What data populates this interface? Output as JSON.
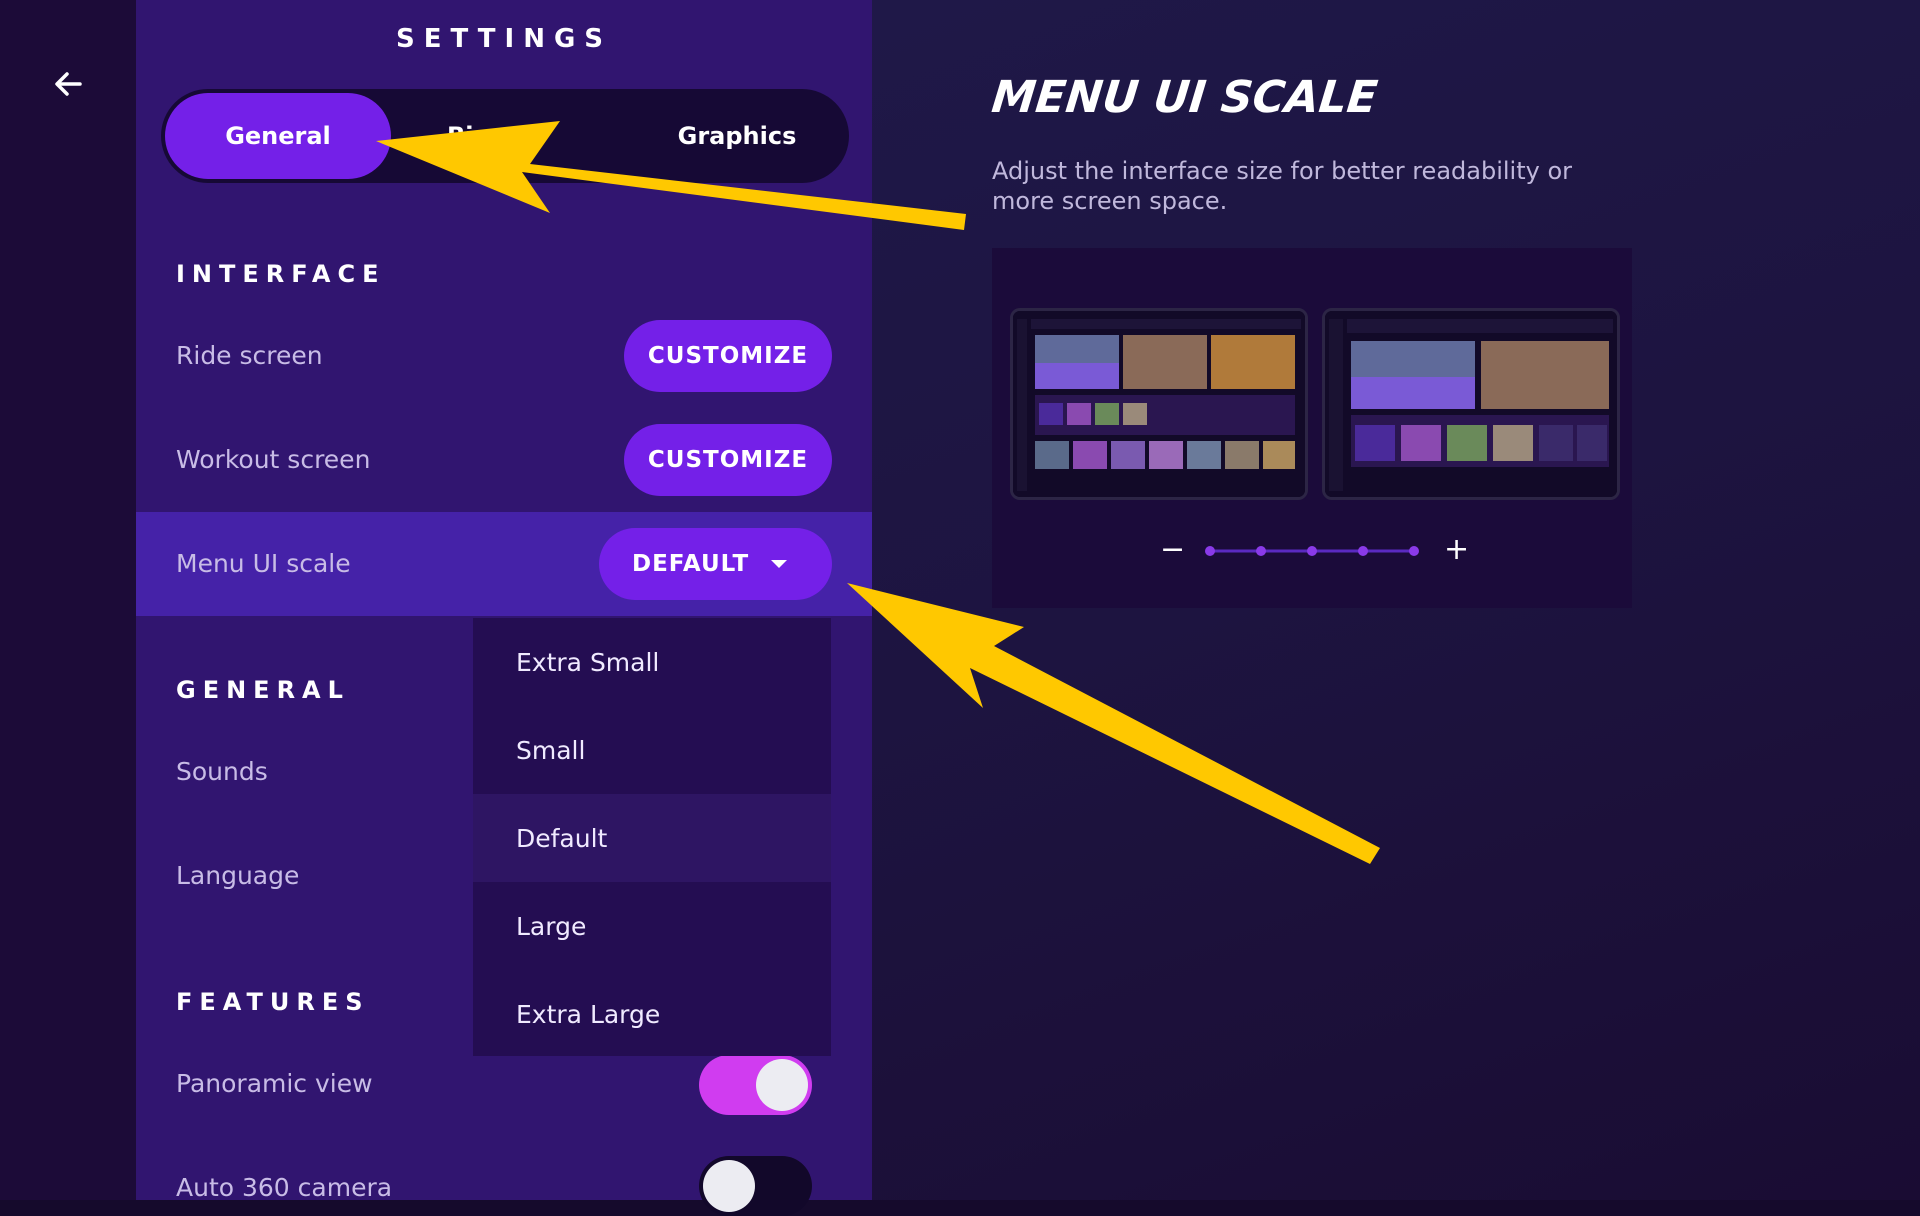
{
  "header": {
    "title": "SETTINGS"
  },
  "tabs": [
    {
      "label": "General",
      "active": true
    },
    {
      "label": "Bi",
      "active": false
    },
    {
      "label": "Graphics",
      "active": false
    }
  ],
  "sections": {
    "interface": {
      "heading": "INTERFACE",
      "ride_screen": {
        "label": "Ride screen",
        "button": "CUSTOMIZE"
      },
      "workout_screen": {
        "label": "Workout screen",
        "button": "CUSTOMIZE"
      },
      "menu_ui_scale": {
        "label": "Menu UI scale",
        "value": "DEFAULT"
      }
    },
    "general": {
      "heading": "GENERAL",
      "sounds": {
        "label": "Sounds"
      },
      "language": {
        "label": "Language"
      }
    },
    "features": {
      "heading": "FEATURES",
      "panoramic_view": {
        "label": "Panoramic view",
        "enabled": true
      },
      "auto_360_camera": {
        "label": "Auto 360 camera",
        "enabled": false
      }
    }
  },
  "dropdown": {
    "options": [
      "Extra Small",
      "Small",
      "Default",
      "Large",
      "Extra Large"
    ],
    "selected": "Default"
  },
  "preview": {
    "title": "MENU UI SCALE",
    "description": "Adjust the interface size for better readability or more screen space.",
    "minus_label": "−",
    "plus_label": "+",
    "scale_steps": 5,
    "scale_index": 0
  },
  "colors": {
    "accent": "#7420e8",
    "toggle_on": "#d03cf0",
    "panel": "#311570",
    "annotation": "#ffc800"
  },
  "icons": {
    "back": "arrow-left-icon",
    "dropdown": "caret-down-icon"
  }
}
